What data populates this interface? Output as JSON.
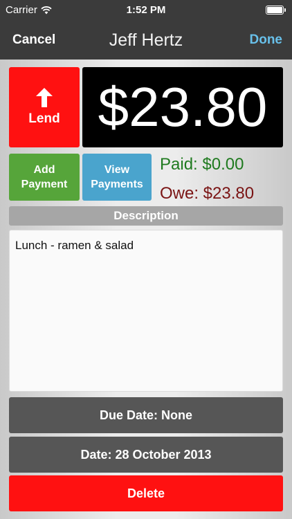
{
  "status_bar": {
    "carrier": "Carrier",
    "time": "1:52 PM"
  },
  "nav": {
    "cancel_label": "Cancel",
    "title": "Jeff Hertz",
    "done_label": "Done"
  },
  "transaction": {
    "type_label": "Lend",
    "amount": "$23.80"
  },
  "payments": {
    "add_label_line1": "Add",
    "add_label_line2": "Payment",
    "view_label_line1": "View",
    "view_label_line2": "Payments",
    "paid": "Paid: $0.00",
    "owe": "Owe: $23.80"
  },
  "description": {
    "header": "Description",
    "text": "Lunch - ramen & salad"
  },
  "due_date_label": "Due Date: None",
  "date_label": "Date: 28 October 2013",
  "delete_label": "Delete",
  "colors": {
    "lend_red": "#ff1111",
    "add_green": "#56a53a",
    "view_blue": "#4aa4cd",
    "paid_green": "#1f7a1f",
    "owe_red": "#7a1414",
    "done_blue": "#68c0ea"
  }
}
